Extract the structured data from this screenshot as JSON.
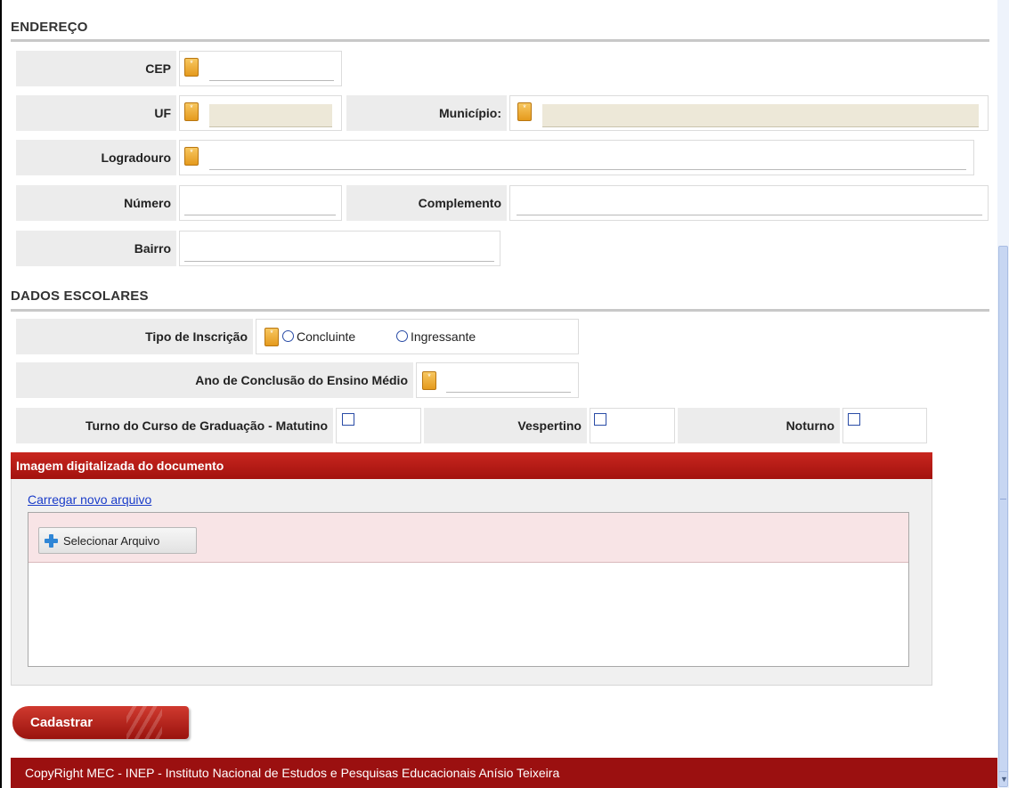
{
  "sections": {
    "endereco": "ENDEREÇO",
    "dados_escolares": "DADOS ESCOLARES"
  },
  "endereco": {
    "cep_label": "CEP",
    "uf_label": "UF",
    "municipio_label": "Município:",
    "logradouro_label": "Logradouro",
    "numero_label": "Número",
    "complemento_label": "Complemento",
    "bairro_label": "Bairro"
  },
  "escolares": {
    "tipo_label": "Tipo de Inscrição",
    "concluinte": "Concluinte",
    "ingressante": "Ingressante",
    "ano_label": "Ano de Conclusão do Ensino Médio",
    "turno_label": "Turno do Curso de Graduação - Matutino",
    "vespertino_label": "Vespertino",
    "noturno_label": "Noturno"
  },
  "documento": {
    "header": "Imagem digitalizada do documento",
    "link": "Carregar novo arquivo",
    "select_button": "Selecionar Arquivo"
  },
  "actions": {
    "submit": "Cadastrar"
  },
  "footer": {
    "text": "CopyRight MEC - INEP - Instituto Nacional de Estudos e Pesquisas Educacionais Anísio Teixeira"
  },
  "colors": {
    "accent": "#a3120e",
    "required": "#e59a1d",
    "link": "#1a3cc9"
  }
}
